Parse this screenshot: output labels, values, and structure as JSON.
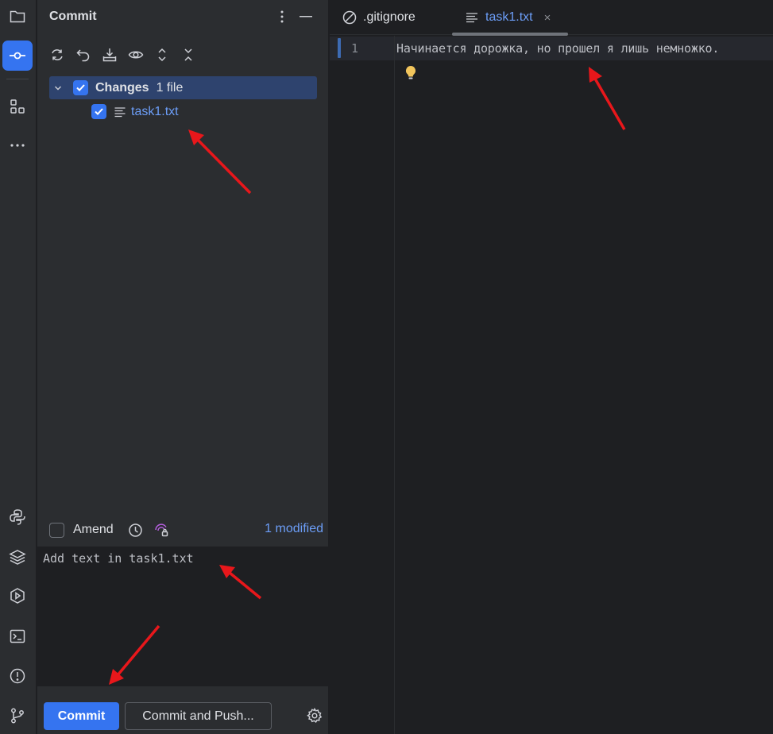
{
  "activity_bar": {
    "items": [
      {
        "icon": "folder-icon"
      },
      {
        "icon": "commit-icon",
        "active": true
      },
      {
        "icon": "structure-icon"
      },
      {
        "icon": "more-icon"
      },
      {
        "icon": "python-icon"
      },
      {
        "icon": "layers-icon"
      },
      {
        "icon": "run-icon"
      },
      {
        "icon": "terminal-icon"
      },
      {
        "icon": "problems-icon"
      },
      {
        "icon": "git-branch-icon"
      }
    ]
  },
  "commit_panel": {
    "title": "Commit",
    "toolbar": [
      "refresh-icon",
      "rollback-icon",
      "shelve-icon",
      "preview-icon",
      "expand-icon",
      "collapse-icon"
    ],
    "changes_group": {
      "label": "Changes",
      "count": "1 file",
      "checked": true
    },
    "files": [
      {
        "name": "task1.txt",
        "checked": true
      }
    ],
    "amend": {
      "label": "Amend",
      "checked": false
    },
    "modified_label": "1 modified",
    "commit_message": "Add text in task1.txt",
    "commit_button": "Commit",
    "commit_push_button": "Commit and Push..."
  },
  "editor": {
    "tabs": [
      {
        "label": ".gitignore",
        "icon": "ignore-file-icon",
        "active": false
      },
      {
        "label": "task1.txt",
        "icon": "text-file-icon",
        "active": true,
        "close": "×"
      }
    ],
    "lines": [
      {
        "number": "1",
        "text": "Начинается дорожка, но прошел я лишь немножко."
      }
    ]
  },
  "colors": {
    "accent": "#3574f0",
    "link": "#6c9ef8",
    "annotation": "#e8171b",
    "panel_bg": "#2b2d30",
    "editor_bg": "#1e1f22"
  }
}
